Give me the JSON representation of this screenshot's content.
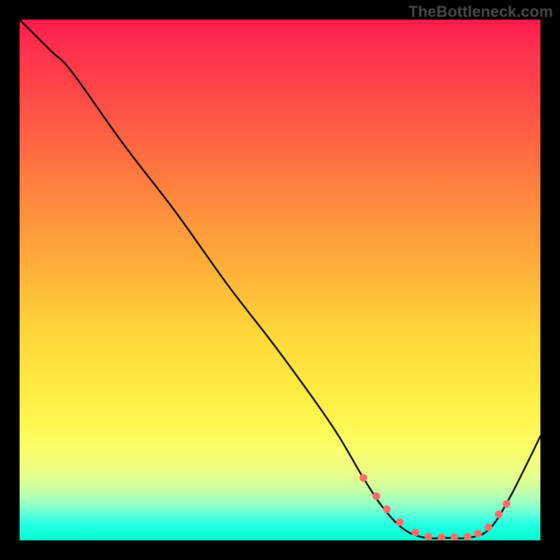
{
  "watermark": "TheBottleneck.com",
  "gradient": {
    "top": "#ff1a4d",
    "mid": "#ffd63a",
    "bottom": "#00ffcf"
  },
  "chart_data": {
    "type": "line",
    "title": "",
    "xlabel": "",
    "ylabel": "",
    "xlim": [
      0,
      100
    ],
    "ylim": [
      0,
      100
    ],
    "series": [
      {
        "name": "bottleneck-curve",
        "x": [
          0,
          6,
          10,
          20,
          30,
          40,
          50,
          60,
          66,
          70,
          74,
          78,
          82,
          86,
          90,
          94,
          100
        ],
        "values": [
          100,
          94,
          90,
          76,
          63,
          49,
          36,
          22,
          12,
          6,
          2,
          0.5,
          0.5,
          0.5,
          2,
          8,
          20
        ]
      }
    ],
    "markers": {
      "name": "highlight-range",
      "color": "#ff6b6b",
      "x": [
        66,
        68.5,
        70.5,
        73,
        76,
        78.5,
        81,
        83.5,
        86,
        88,
        90,
        92,
        93.5
      ],
      "values": [
        12,
        8.5,
        6,
        3.5,
        1.5,
        0.7,
        0.6,
        0.6,
        0.7,
        1.3,
        2.5,
        5,
        7
      ]
    }
  }
}
